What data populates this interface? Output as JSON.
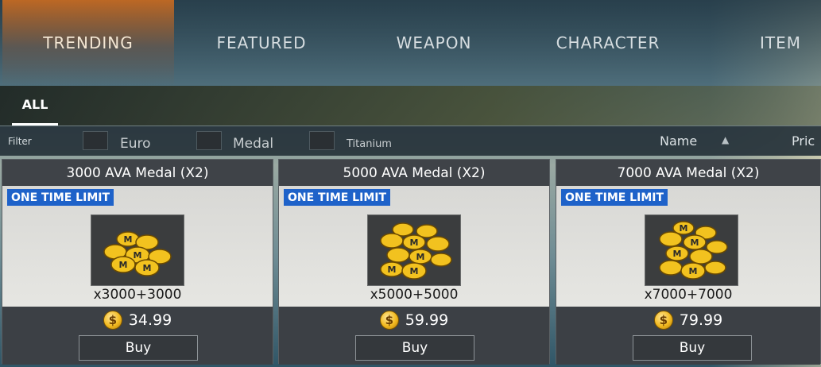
{
  "nav": {
    "tabs": [
      {
        "label": "TRENDING",
        "active": true
      },
      {
        "label": "FEATURED",
        "active": false
      },
      {
        "label": "WEAPON",
        "active": false
      },
      {
        "label": "CHARACTER",
        "active": false
      },
      {
        "label": "ITEM",
        "active": false
      }
    ]
  },
  "subnav": {
    "tab": "ALL"
  },
  "filter": {
    "label": "Filter",
    "options": [
      {
        "label": "Euro",
        "checked": false
      },
      {
        "label": "Medal",
        "checked": false
      },
      {
        "label": "Titanium",
        "checked": false
      }
    ],
    "sort": {
      "name": "Name",
      "price": "Pric",
      "direction_icon": "triangle-up-icon"
    }
  },
  "colors": {
    "active_tab": "#cc6c20",
    "badge": "#1e62c9",
    "coin": "#f2b91f"
  },
  "products": [
    {
      "title": "3000 AVA Medal (X2)",
      "badge": "ONE TIME LIMIT",
      "quantity": "x3000+3000",
      "price": "34.99",
      "currency_symbol": "$",
      "buy_label": "Buy",
      "icon": "medal-coins-icon"
    },
    {
      "title": "5000 AVA Medal (X2)",
      "badge": "ONE TIME LIMIT",
      "quantity": "x5000+5000",
      "price": "59.99",
      "currency_symbol": "$",
      "buy_label": "Buy",
      "icon": "medal-coins-icon"
    },
    {
      "title": "7000 AVA Medal (X2)",
      "badge": "ONE TIME LIMIT",
      "quantity": "x7000+7000",
      "price": "79.99",
      "currency_symbol": "$",
      "buy_label": "Buy",
      "icon": "medal-coins-icon"
    }
  ]
}
